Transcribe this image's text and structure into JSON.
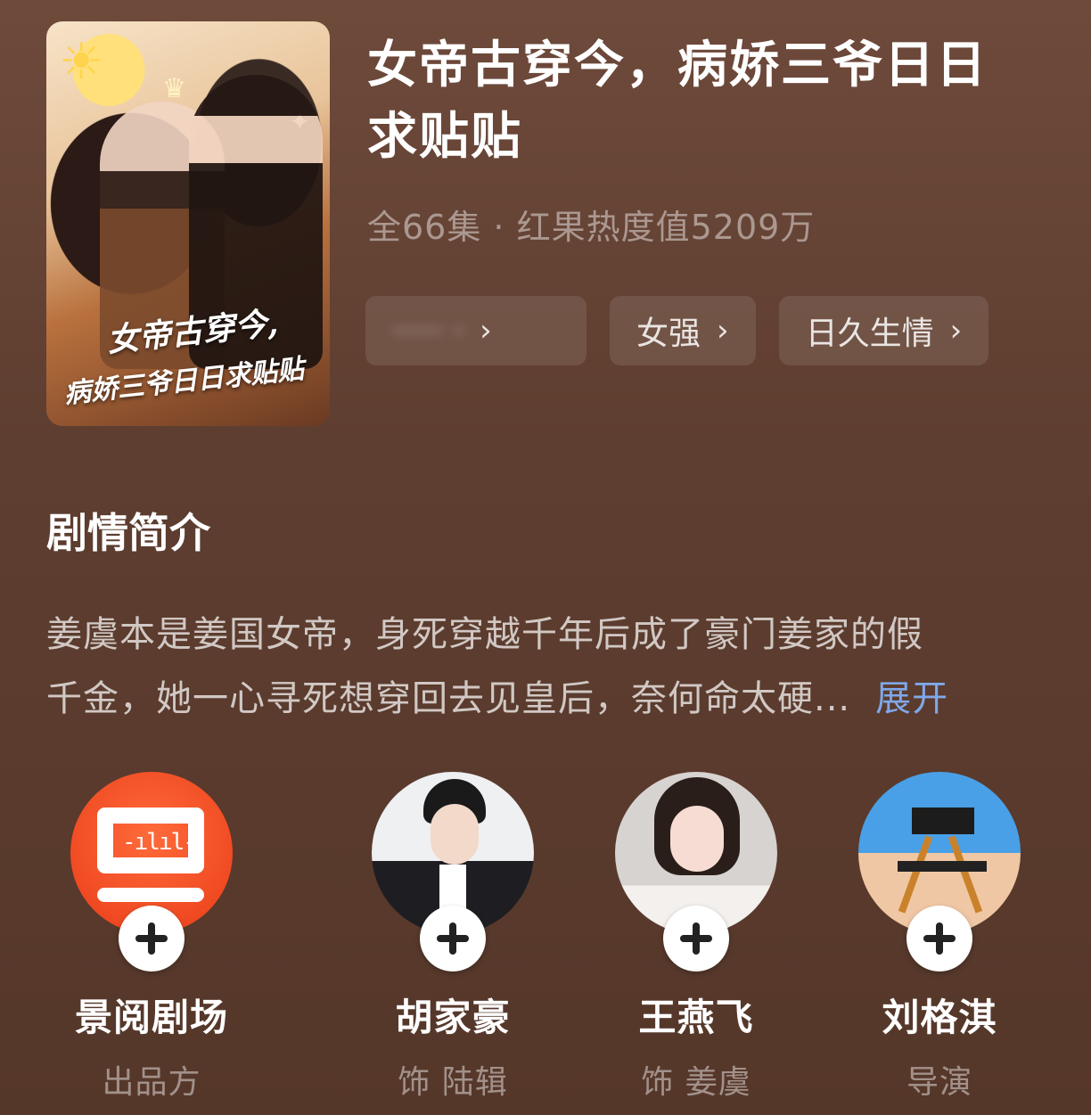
{
  "poster": {
    "title_line1": "女帝古穿今,",
    "title_line2": "病娇三爷日日求贴贴"
  },
  "drama": {
    "title": "女帝古穿今，病娇三爷日日求贴贴",
    "meta": "全66集 · 红果热度值5209万",
    "tags": [
      {
        "label": "····· ·",
        "blurred": true
      },
      {
        "label": "女强"
      },
      {
        "label": "日久生情"
      }
    ]
  },
  "synopsis": {
    "heading": "剧情简介",
    "line1": "姜虞本是姜国女帝，身死穿越千年后成了豪门姜家的假",
    "line2": "千金，她一心寻死想穿回去见皇后，奈何命太硬...",
    "expand_label": "展开"
  },
  "people": [
    {
      "name": "景阅剧场",
      "role": "出品方",
      "avatar": "studio-logo"
    },
    {
      "name": "胡家豪",
      "role": "饰 陆辑",
      "avatar": "actor-photo"
    },
    {
      "name": "王燕飞",
      "role": "饰 姜虞",
      "avatar": "actress-photo"
    },
    {
      "name": "刘格淇",
      "role": "导演",
      "avatar": "director-chair"
    }
  ],
  "icons": {
    "tag_chevron": "chevron-right-icon",
    "follow": "plus-icon"
  },
  "colors": {
    "background": "#5e3e30",
    "expand_link": "#7fa8ea",
    "studio_logo": "#f04a22"
  }
}
